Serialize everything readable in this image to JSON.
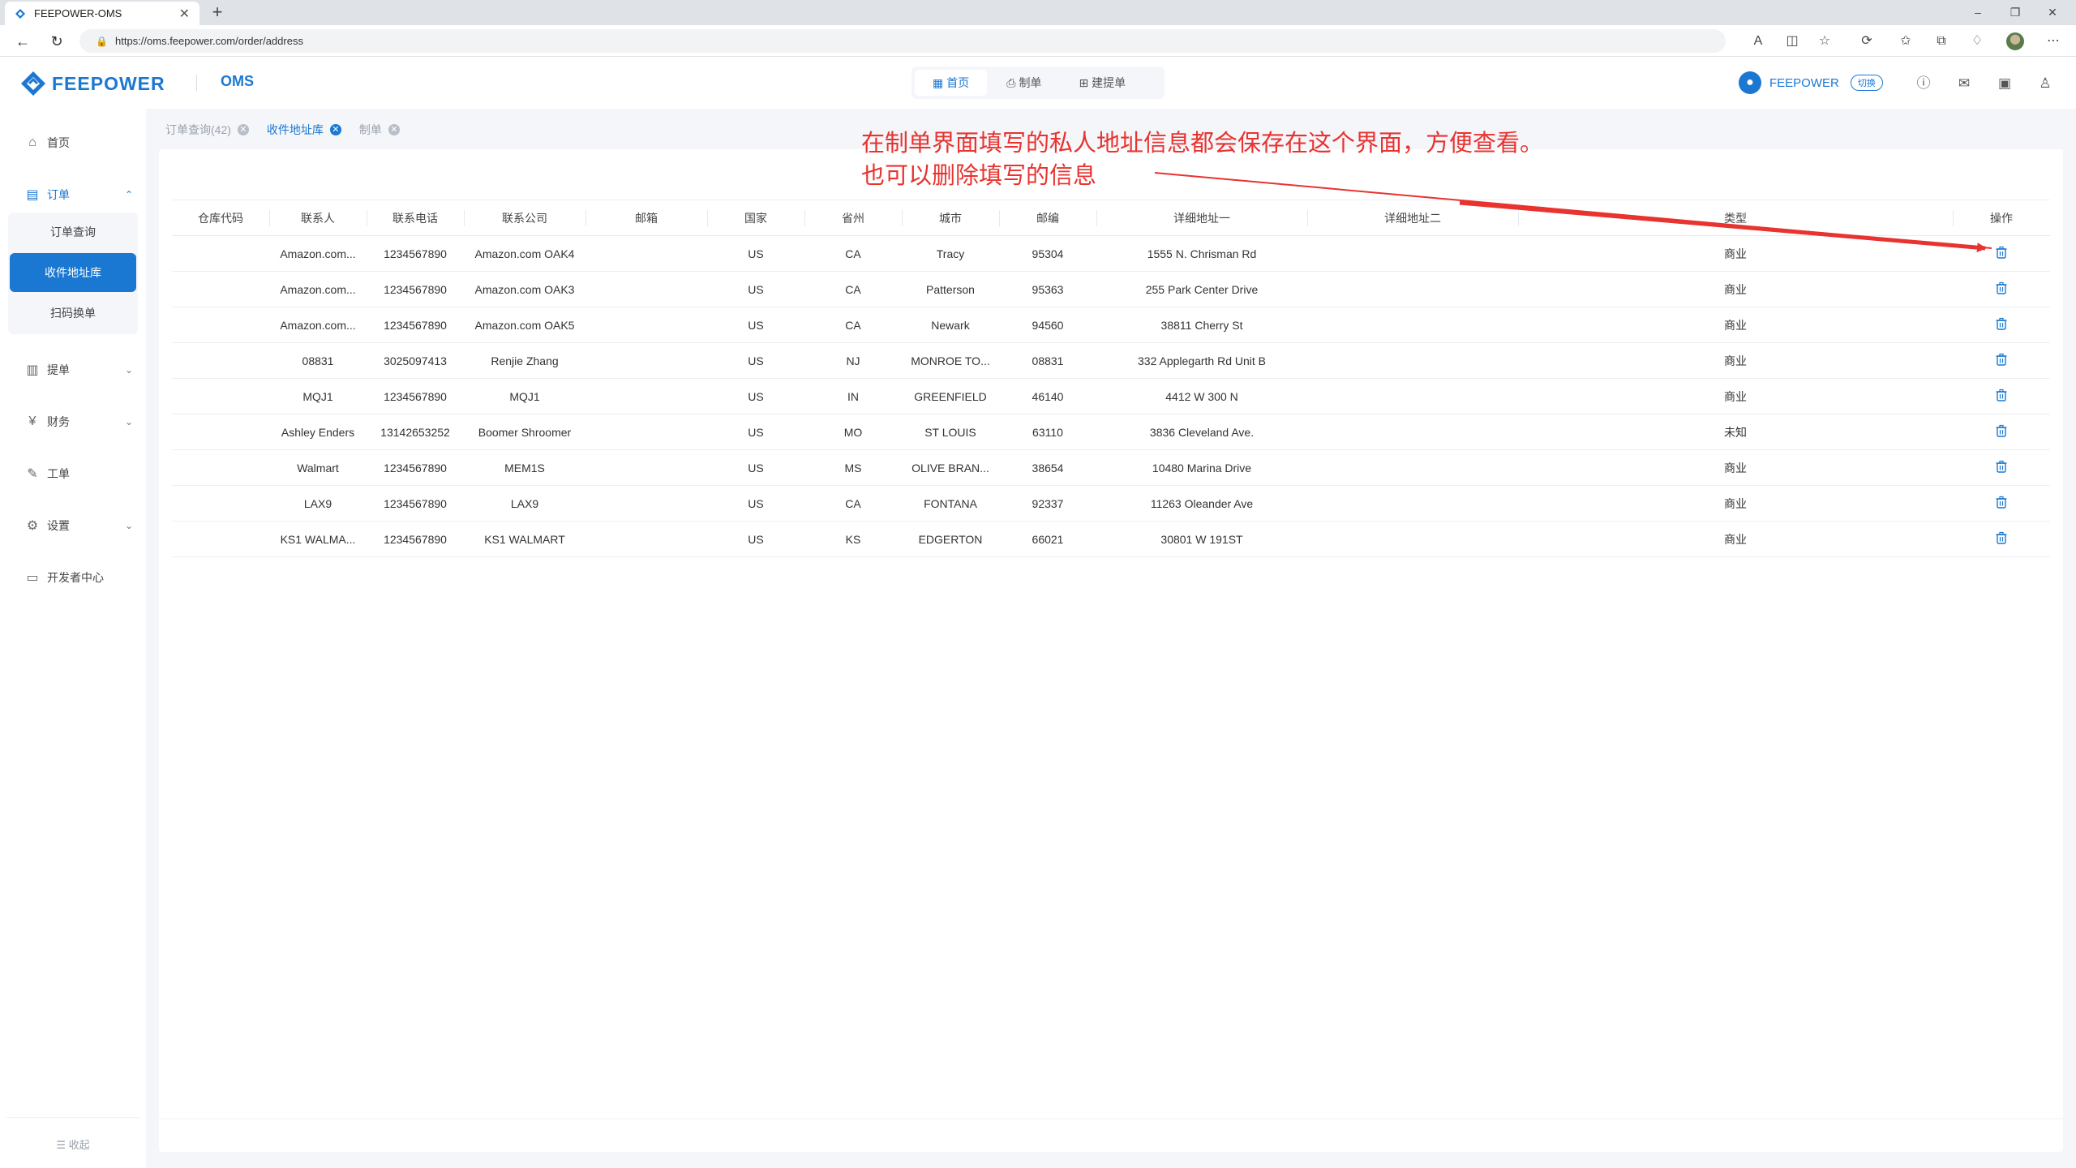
{
  "browser": {
    "tab_title": "FEEPOWER-OMS",
    "url": "https://oms.feepower.com/order/address"
  },
  "header": {
    "brand": "FEEPOWER",
    "product": "OMS",
    "nav": [
      {
        "label": "首页",
        "icon": "grid-icon"
      },
      {
        "label": "制单",
        "icon": "printer-user-icon"
      },
      {
        "label": "建提单",
        "icon": "add-document-icon"
      }
    ],
    "user_name": "FEEPOWER",
    "switch_label": "切换"
  },
  "sidebar": {
    "items": [
      {
        "label": "首页",
        "icon": "home-icon"
      },
      {
        "label": "订单",
        "icon": "document-icon"
      },
      {
        "label": "提单",
        "icon": "clipboard-icon"
      },
      {
        "label": "财务",
        "icon": "finance-icon"
      },
      {
        "label": "工单",
        "icon": "ticket-icon"
      },
      {
        "label": "设置",
        "icon": "settings-icon"
      },
      {
        "label": "开发者中心",
        "icon": "developer-icon"
      }
    ],
    "order_sub": [
      {
        "label": "订单查询"
      },
      {
        "label": "收件地址库"
      },
      {
        "label": "扫码换单"
      }
    ],
    "collapse_label": "收起"
  },
  "page_tabs": [
    {
      "label": "订单查询(42)"
    },
    {
      "label": "收件地址库"
    },
    {
      "label": "制单"
    }
  ],
  "table": {
    "columns": [
      "仓库代码",
      "联系人",
      "联系电话",
      "联系公司",
      "邮箱",
      "国家",
      "省州",
      "城市",
      "邮编",
      "详细地址一",
      "详细地址二",
      "类型",
      "操作"
    ],
    "rows": [
      {
        "warehouse": "",
        "contact": "Amazon.com...",
        "phone": "1234567890",
        "company": "Amazon.com OAK4",
        "email": "",
        "country": "US",
        "state": "CA",
        "city": "Tracy",
        "zip": "95304",
        "addr1": "1555 N. Chrisman Rd",
        "addr2": "",
        "type": "商业"
      },
      {
        "warehouse": "",
        "contact": "Amazon.com...",
        "phone": "1234567890",
        "company": "Amazon.com OAK3",
        "email": "",
        "country": "US",
        "state": "CA",
        "city": "Patterson",
        "zip": "95363",
        "addr1": "255 Park Center Drive",
        "addr2": "",
        "type": "商业"
      },
      {
        "warehouse": "",
        "contact": "Amazon.com...",
        "phone": "1234567890",
        "company": "Amazon.com OAK5",
        "email": "",
        "country": "US",
        "state": "CA",
        "city": "Newark",
        "zip": "94560",
        "addr1": "38811 Cherry St",
        "addr2": "",
        "type": "商业"
      },
      {
        "warehouse": "",
        "contact": "08831",
        "phone": "3025097413",
        "company": "Renjie Zhang",
        "email": "",
        "country": "US",
        "state": "NJ",
        "city": "MONROE TO...",
        "zip": "08831",
        "addr1": "332 Applegarth Rd Unit B",
        "addr2": "",
        "type": "商业"
      },
      {
        "warehouse": "",
        "contact": "MQJ1",
        "phone": "1234567890",
        "company": "MQJ1",
        "email": "",
        "country": "US",
        "state": "IN",
        "city": "GREENFIELD",
        "zip": "46140",
        "addr1": "4412 W 300 N",
        "addr2": "",
        "type": "商业"
      },
      {
        "warehouse": "",
        "contact": "Ashley Enders",
        "phone": "13142653252",
        "company": "Boomer Shroomer",
        "email": "",
        "country": "US",
        "state": "MO",
        "city": "ST LOUIS",
        "zip": "63110",
        "addr1": "3836 Cleveland Ave.",
        "addr2": "",
        "type": "未知"
      },
      {
        "warehouse": "",
        "contact": "Walmart",
        "phone": "1234567890",
        "company": "MEM1S",
        "email": "",
        "country": "US",
        "state": "MS",
        "city": "OLIVE BRAN...",
        "zip": "38654",
        "addr1": "10480 Marina Drive",
        "addr2": "",
        "type": "商业"
      },
      {
        "warehouse": "",
        "contact": "LAX9",
        "phone": "1234567890",
        "company": "LAX9",
        "email": "",
        "country": "US",
        "state": "CA",
        "city": "FONTANA",
        "zip": "92337",
        "addr1": "11263 Oleander Ave",
        "addr2": "",
        "type": "商业"
      },
      {
        "warehouse": "",
        "contact": "KS1 WALMA...",
        "phone": "1234567890",
        "company": "KS1 WALMART",
        "email": "",
        "country": "US",
        "state": "KS",
        "city": "EDGERTON",
        "zip": "66021",
        "addr1": "30801 W 191ST",
        "addr2": "",
        "type": "商业"
      }
    ]
  },
  "annotation": {
    "line1": "在制单界面填写的私人地址信息都会保存在这个界面，方便查看。",
    "line2": "也可以删除填写的信息",
    "color": "#e8332f"
  },
  "colors": {
    "brand": "#1a78d2",
    "background": "#f4f6fa"
  }
}
